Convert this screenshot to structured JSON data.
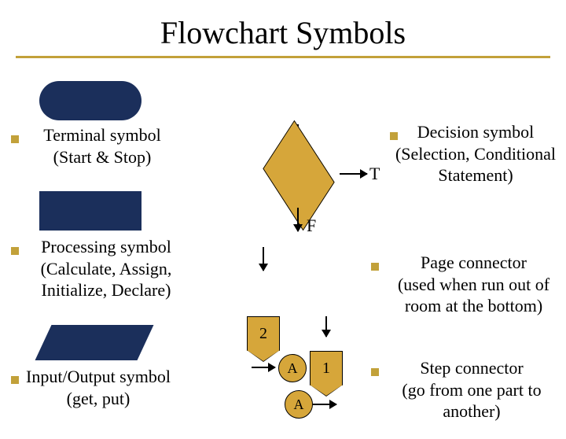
{
  "title": "Flowchart Symbols",
  "terminal": {
    "name": "Terminal symbol",
    "desc": "(Start & Stop)"
  },
  "process": {
    "name": "Processing symbol",
    "desc": "(Calculate, Assign, Initialize, Declare)"
  },
  "io": {
    "name": "Input/Output symbol",
    "desc": "(get, put)"
  },
  "decision": {
    "name": "Decision symbol",
    "desc1": "(Selection, Conditional",
    "desc2": "Statement)",
    "T": "T",
    "F": "F"
  },
  "pageconn": {
    "label2": "2",
    "label1": "1",
    "name": "Page connector",
    "desc1": "(used when run out of",
    "desc2": "room at the bottom)"
  },
  "stepconn": {
    "labelA": "A",
    "name": "Step connector",
    "desc1": "(go from one part to",
    "desc2": "another)"
  }
}
